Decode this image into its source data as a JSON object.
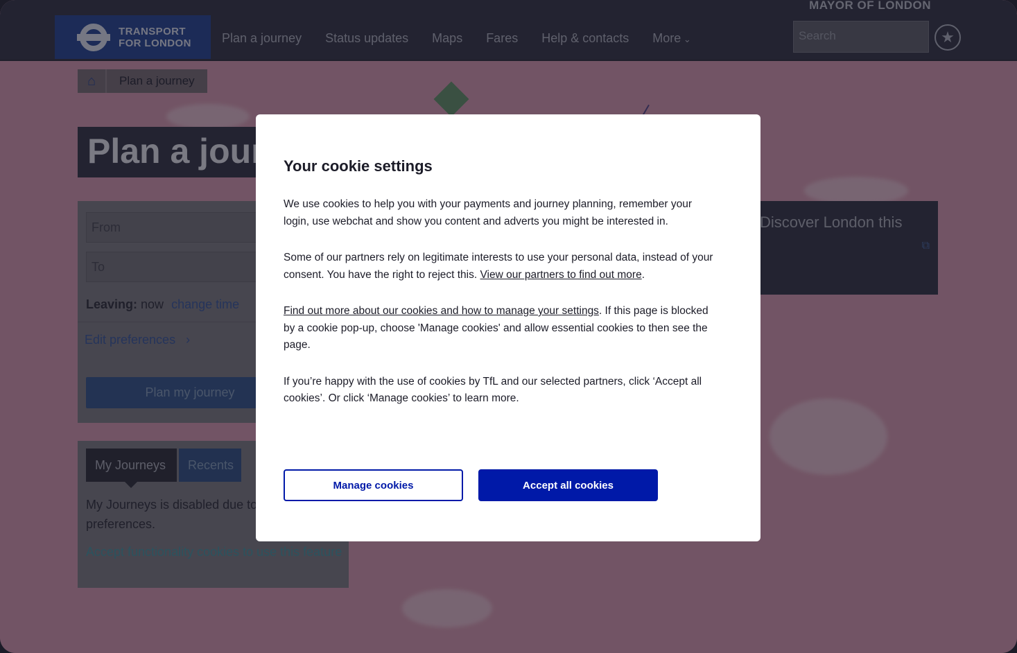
{
  "header": {
    "mayor_label": "MAYOR OF LONDON",
    "logo_line1": "TRANSPORT",
    "logo_line2": "FOR LONDON",
    "nav": [
      "Plan a journey",
      "Status updates",
      "Maps",
      "Fares",
      "Help & contacts",
      "More"
    ],
    "search_placeholder": "Search"
  },
  "breadcrumb": {
    "current": "Plan a journey"
  },
  "page_title": "Plan a journey",
  "planner": {
    "from_placeholder": "From",
    "to_placeholder": "To",
    "leaving_label": "Leaving:",
    "leaving_value": "now",
    "change_time": "change time",
    "edit_preferences": "Edit preferences",
    "plan_button": "Plan my journey"
  },
  "journeys": {
    "tab_my": "My Journeys",
    "tab_recents": "Recents",
    "message": "My Journeys is disabled due to your cookie preferences.",
    "accept_link": "Accept functionality cookies to use this feature"
  },
  "promo": {
    "text": "Discover London this"
  },
  "cookie_dialog": {
    "title": "Your cookie settings",
    "para1": "We use cookies to help you with your payments and journey planning, remember your login, use webchat and show you content and adverts you might be interested in.",
    "para2_text": "Some of our partners rely on legitimate interests to use your personal data, instead of your consent. You have the right to reject this. ",
    "para2_link": "View our partners to find out more",
    "para3_link": "Find out more about our cookies and how to manage your settings",
    "para3_text": ". If this page is blocked by a cookie pop-up, choose 'Manage cookies' and allow essential cookies to then see the page.",
    "para4": "If you’re happy with the use of cookies by TfL and our selected partners, click ‘Accept all cookies’. Or click ‘Manage cookies’ to learn more.",
    "manage_button": "Manage cookies",
    "accept_button": "Accept all cookies"
  },
  "colors": {
    "brand_blue": "#0019a8",
    "page_pink": "#c98da2",
    "header_dark": "#2a2b3a"
  }
}
